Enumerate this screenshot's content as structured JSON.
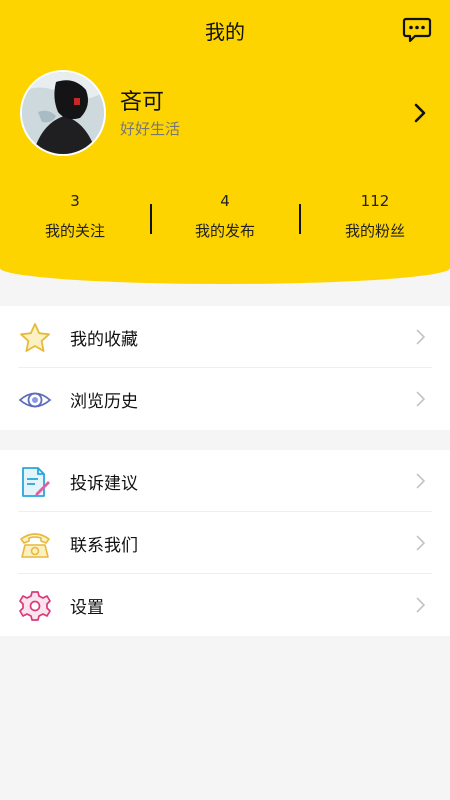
{
  "header": {
    "title": "我的",
    "message_icon": "chat-bubble-icon"
  },
  "profile": {
    "name": "吝可",
    "bio": "好好生活"
  },
  "stats": [
    {
      "count": "3",
      "label": "我的关注"
    },
    {
      "count": "4",
      "label": "我的发布"
    },
    {
      "count": "112",
      "label": "我的粉丝"
    }
  ],
  "menu": {
    "group1": [
      {
        "label": "我的收藏",
        "icon": "star-icon"
      },
      {
        "label": "浏览历史",
        "icon": "eye-icon"
      }
    ],
    "group2": [
      {
        "label": "投诉建议",
        "icon": "document-edit-icon"
      },
      {
        "label": "联系我们",
        "icon": "telephone-icon"
      },
      {
        "label": "设置",
        "icon": "gear-icon"
      }
    ]
  },
  "colors": {
    "accent": "#fdd400",
    "background": "#f5f5f5"
  }
}
